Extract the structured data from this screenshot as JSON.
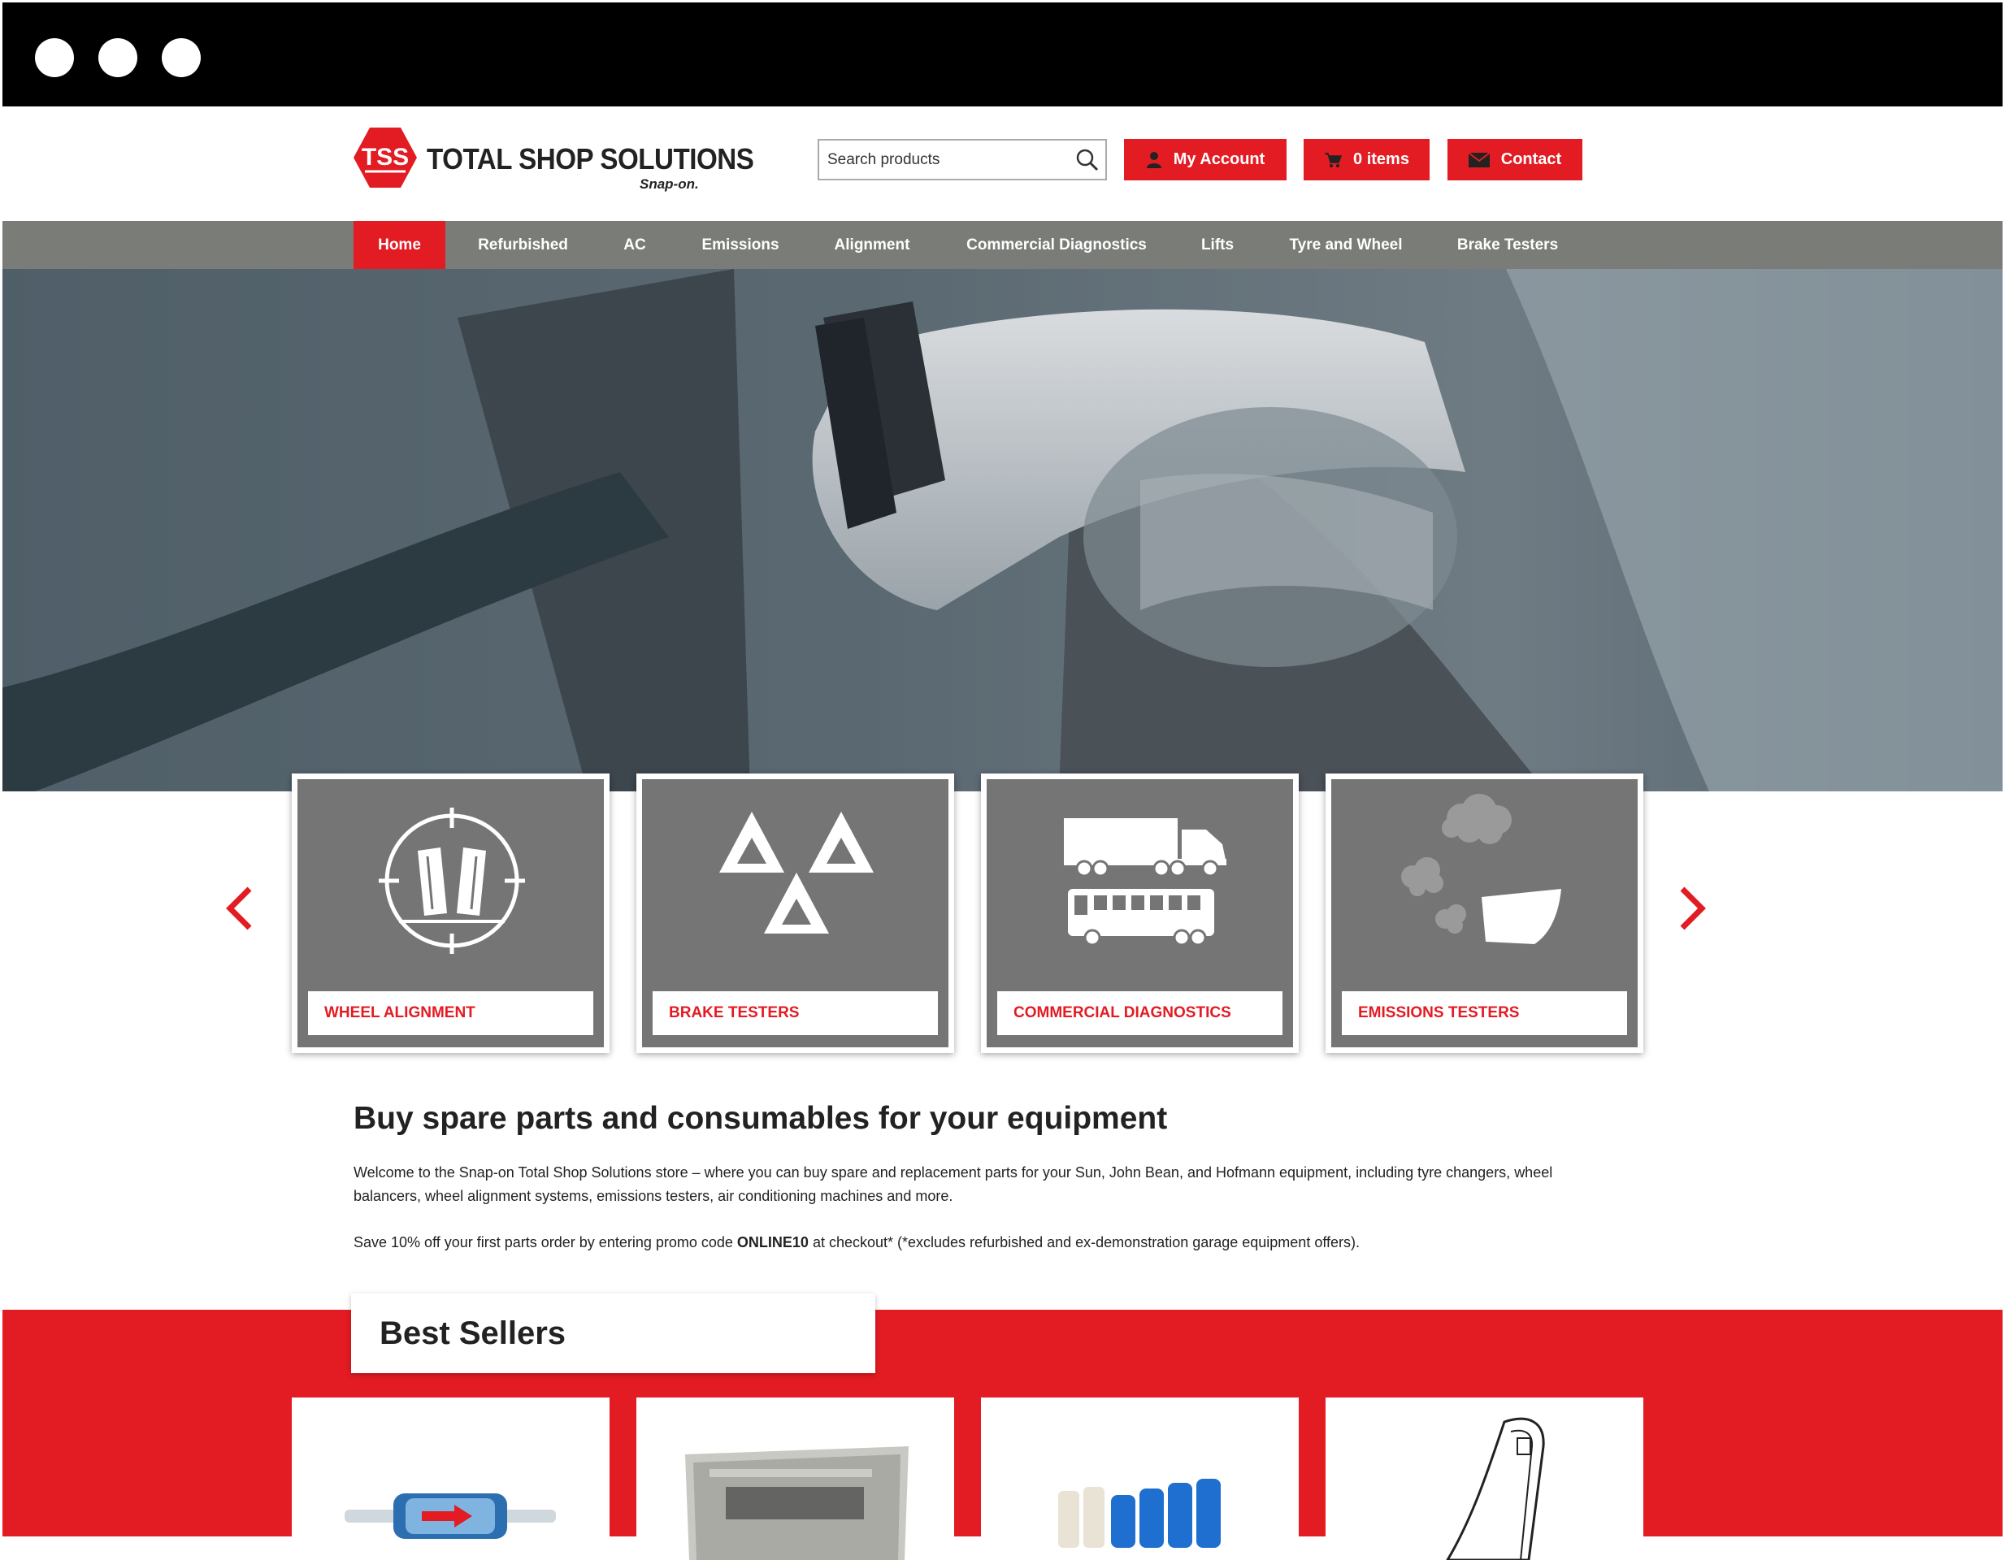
{
  "window": {
    "controls": [
      "close",
      "minimize",
      "maximize"
    ]
  },
  "brand": {
    "badge": "TSS",
    "name": "TOTAL SHOP SOLUTIONS",
    "sub": "Snap-on.",
    "color": "#e31b23"
  },
  "header": {
    "search_placeholder": "Search products",
    "account_label": "My Account",
    "cart_label": "0 items",
    "contact_label": "Contact"
  },
  "nav": {
    "items": [
      {
        "label": "Home",
        "active": true
      },
      {
        "label": "Refurbished"
      },
      {
        "label": "AC"
      },
      {
        "label": "Emissions"
      },
      {
        "label": "Alignment"
      },
      {
        "label": "Commercial Diagnostics"
      },
      {
        "label": "Lifts"
      },
      {
        "label": "Tyre and Wheel"
      },
      {
        "label": "Brake Testers"
      }
    ]
  },
  "categories": [
    {
      "label": "WHEEL ALIGNMENT",
      "icon": "wheel-alignment-icon"
    },
    {
      "label": "BRAKE TESTERS",
      "icon": "brake-tester-icon"
    },
    {
      "label": "COMMERCIAL DIAGNOSTICS",
      "icon": "commercial-vehicles-icon"
    },
    {
      "label": "EMISSIONS TESTERS",
      "icon": "emissions-icon"
    }
  ],
  "intro": {
    "heading": "Buy spare parts and consumables for your equipment",
    "body": "Welcome to the Snap-on Total Shop Solutions store – where you can buy spare and replacement parts for your Sun, John Bean, and Hofmann equipment, including tyre changers, wheel balancers, wheel alignment systems, emissions testers, air conditioning machines and more.",
    "promo_before": "Save 10% off your first parts order by entering promo code ",
    "promo_code": "ONLINE10",
    "promo_after": " at checkout* (*excludes refurbished and ex-demonstration garage equipment offers)."
  },
  "best_sellers": {
    "title": "Best Sellers",
    "products": [
      "inline-filter",
      "spare-part-bag",
      "blue-connectors",
      "clip-part"
    ]
  }
}
